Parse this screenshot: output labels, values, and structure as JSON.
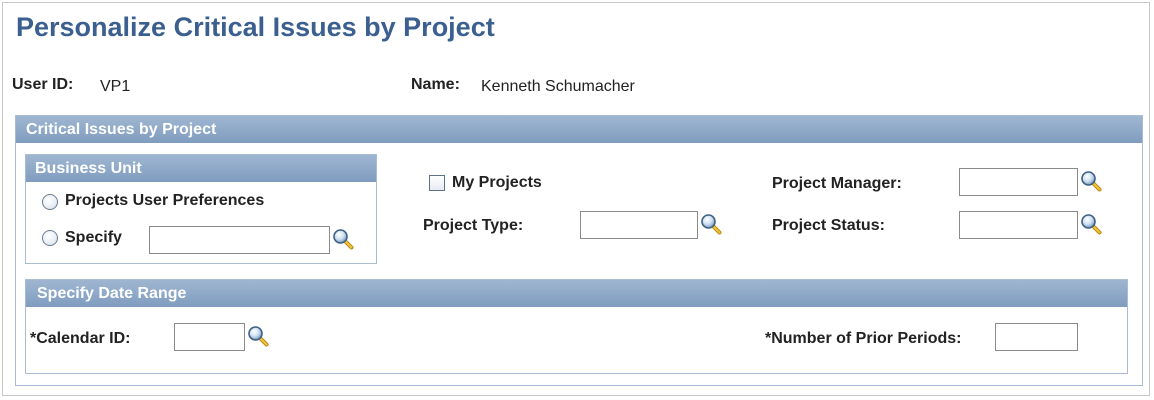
{
  "page": {
    "title": "Personalize Critical Issues by Project"
  },
  "user": {
    "user_id_label": "User ID:",
    "user_id_value": "VP1",
    "name_label": "Name:",
    "name_value": "Kenneth Schumacher"
  },
  "critical_section": {
    "header": "Critical Issues by Project"
  },
  "business_unit": {
    "header": "Business Unit",
    "option_preferences": "Projects User Preferences",
    "option_specify": "Specify",
    "specify_value": ""
  },
  "filters": {
    "my_projects_label": "My Projects",
    "my_projects_checked": false,
    "project_type_label": "Project Type:",
    "project_type_value": "",
    "project_manager_label": "Project Manager:",
    "project_manager_value": "",
    "project_status_label": "Project Status:",
    "project_status_value": ""
  },
  "date_range": {
    "header": "Specify Date Range",
    "calendar_id_label": "*Calendar ID:",
    "calendar_id_value": "",
    "prior_periods_label": "*Number of Prior Periods:",
    "prior_periods_value": ""
  },
  "icons": {
    "lookup": "magnifier-lookup-icon"
  }
}
